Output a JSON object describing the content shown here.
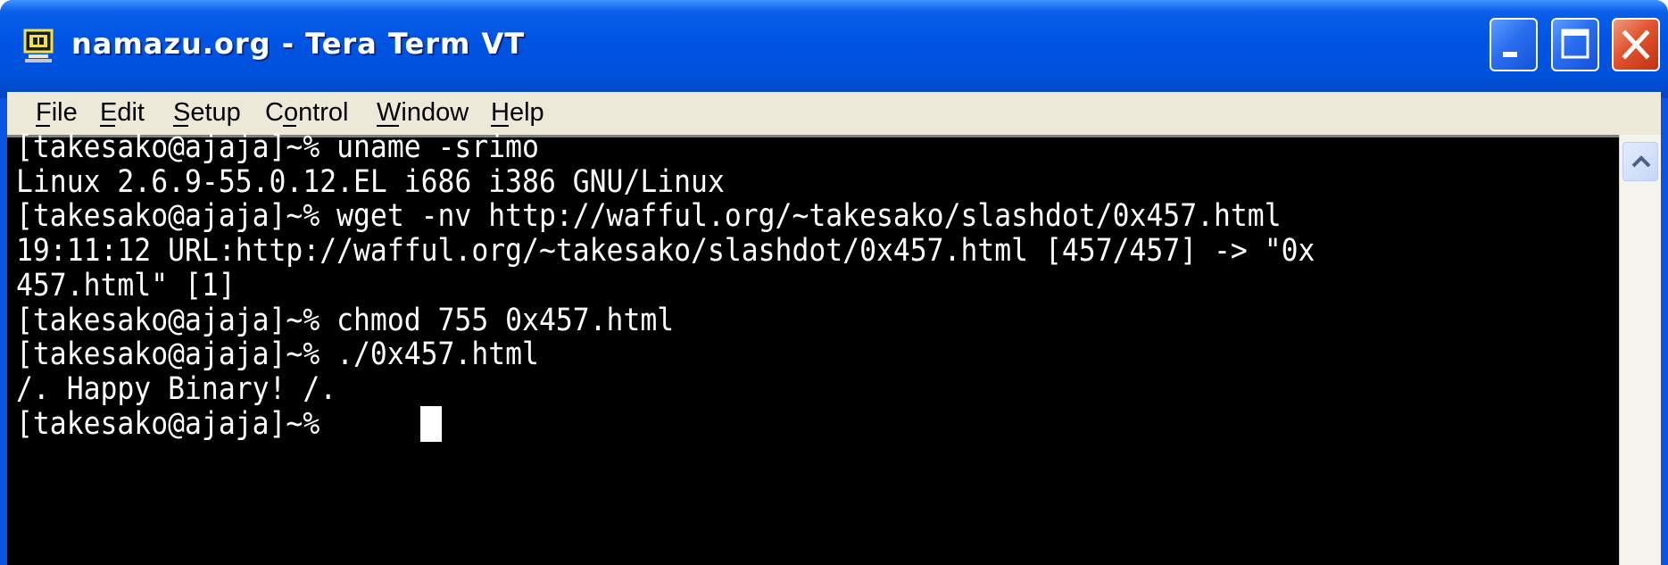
{
  "window": {
    "title": "namazu.org - Tera Term VT",
    "icon": "teraterm-app-icon",
    "controls": [
      "minimize-icon",
      "maximize-icon",
      "close-icon"
    ]
  },
  "menu": {
    "items": [
      {
        "label": "File",
        "accel": "F"
      },
      {
        "label": "Edit",
        "accel": "E"
      },
      {
        "label": "Setup",
        "accel": "S"
      },
      {
        "label": "Control",
        "accel": "o"
      },
      {
        "label": "Window",
        "accel": "W"
      },
      {
        "label": "Help",
        "accel": "H"
      }
    ]
  },
  "terminal": {
    "background": "#000000",
    "foreground": "#ffffff",
    "lines": [
      "[takesako@ajaja]~% uname -srimo",
      "Linux 2.6.9-55.0.12.EL i686 i386 GNU/Linux",
      "[takesako@ajaja]~% wget -nv http://wafful.org/~takesako/slashdot/0x457.html",
      "19:11:12 URL:http://wafful.org/~takesako/slashdot/0x457.html [457/457] -> \"0x",
      "457.html\" [1]",
      "[takesako@ajaja]~% chmod 755 0x457.html",
      "[takesako@ajaja]~% ./0x457.html",
      "/. Happy Binary! /.",
      "[takesako@ajaja]~% "
    ]
  },
  "scrollbar": {
    "up_icon": "scroll-up-arrow-icon"
  }
}
